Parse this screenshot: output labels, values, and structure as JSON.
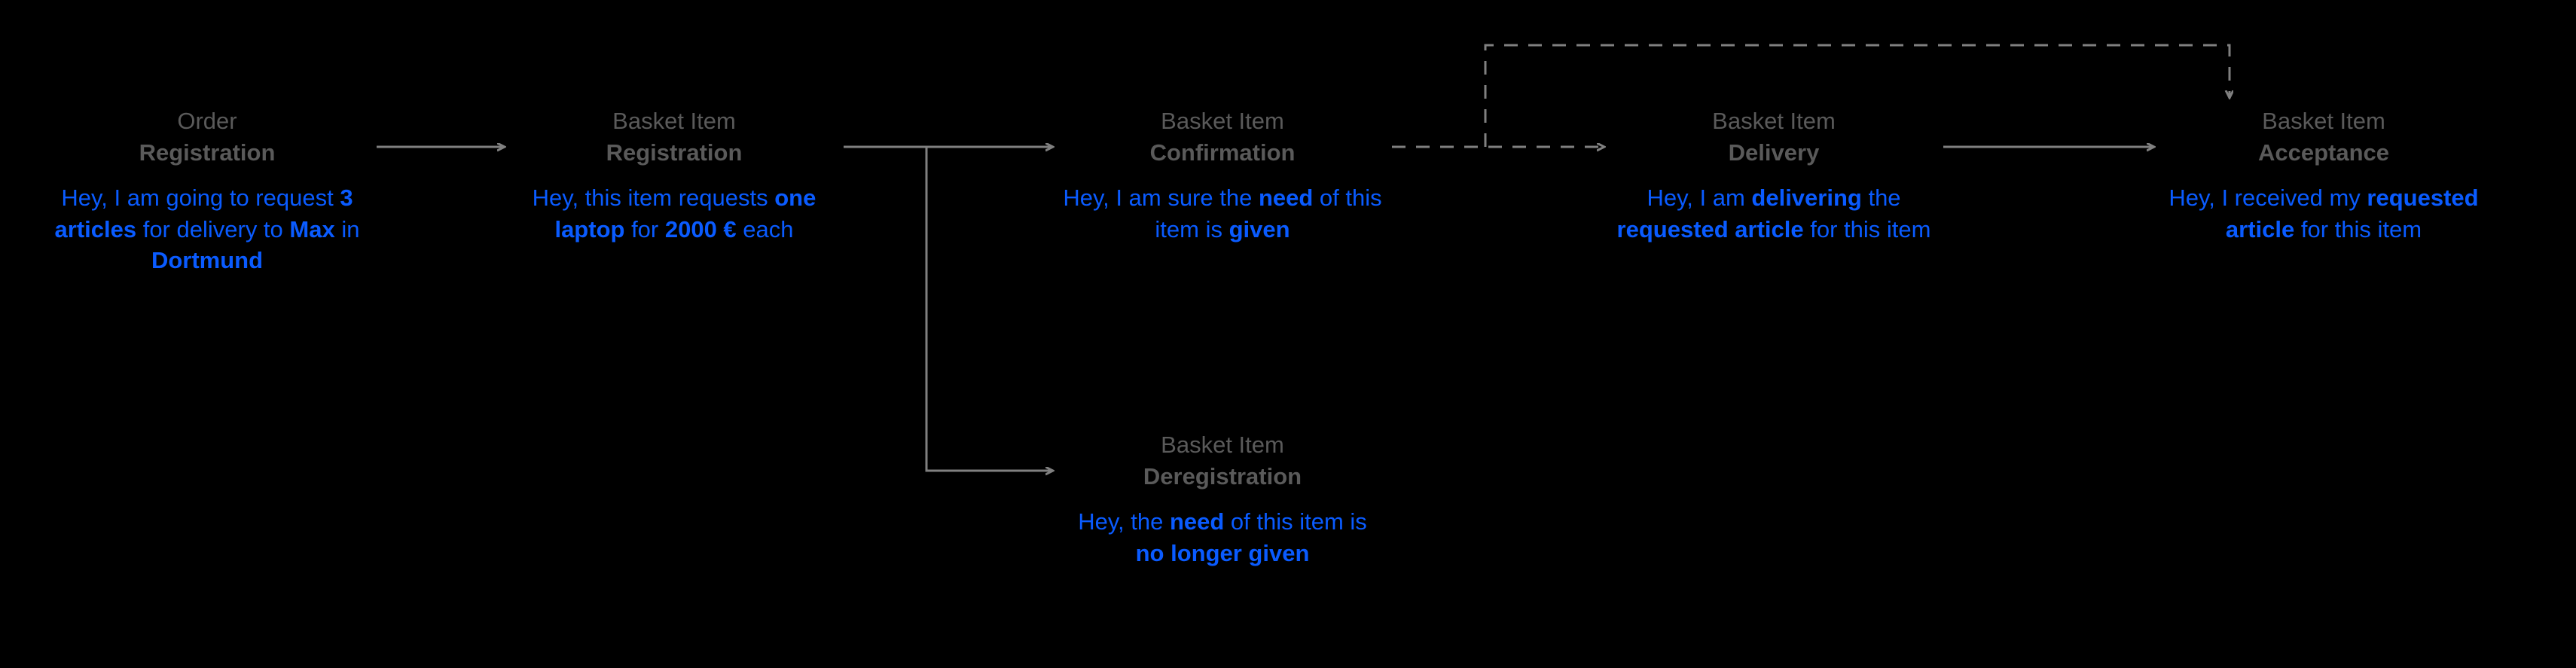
{
  "nodes": {
    "order_registration": {
      "title_line1": "Order",
      "title_line2": "Registration",
      "desc_html": "Hey, I am going to request <b>3 articles</b> for delivery to <b>Max</b> in <b>Dortmund</b>"
    },
    "basket_registration": {
      "title_line1": "Basket Item",
      "title_line2": "Registration",
      "desc_html": "Hey, this item requests <b>one laptop</b>  for <b>2000 €</b> each"
    },
    "basket_confirmation": {
      "title_line1": "Basket Item",
      "title_line2": "Confirmation",
      "desc_html": "Hey, I am sure the <b>need</b> of this item is <b>given</b>"
    },
    "basket_deregistration": {
      "title_line1": "Basket Item",
      "title_line2": "Deregistration",
      "desc_html": "Hey, the <b>need</b> of this item is <b>no longer given</b>"
    },
    "basket_delivery": {
      "title_line1": "Basket Item",
      "title_line2": "Delivery",
      "desc_html": "Hey, I am <b>delivering</b> the <b>requested article</b> for this item"
    },
    "basket_acceptance": {
      "title_line1": "Basket Item",
      "title_line2": "Acceptance",
      "desc_html": "Hey, I received my <b>requested article</b> for this item"
    }
  }
}
